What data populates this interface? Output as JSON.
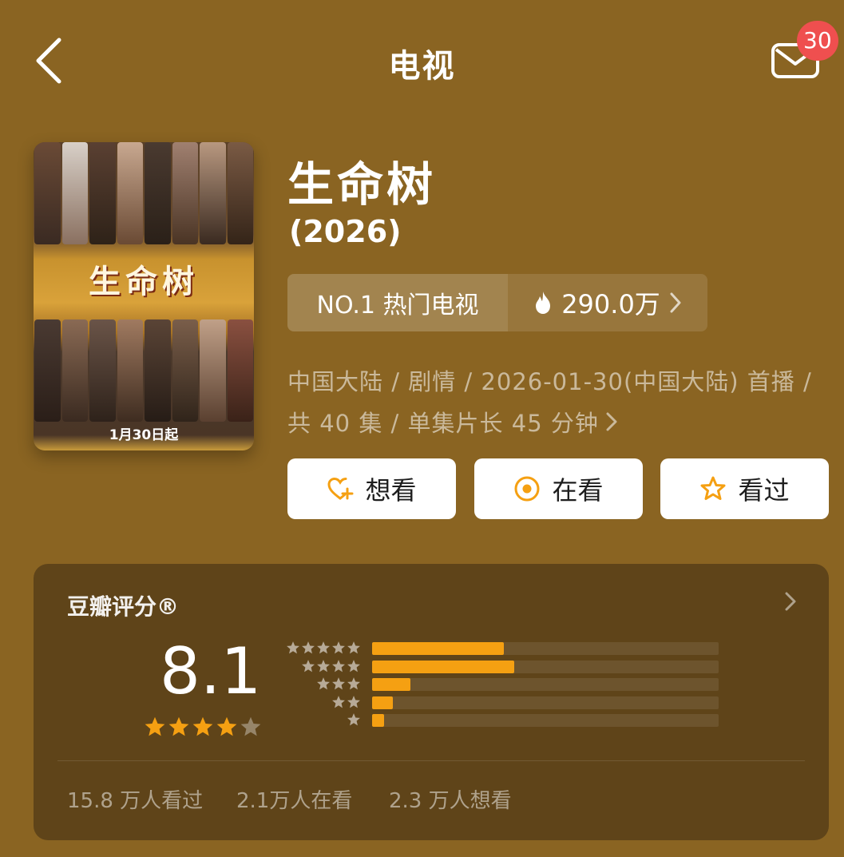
{
  "header": {
    "title": "电视",
    "badge_count": "30",
    "back_icon": "chevron-left-icon",
    "mail_icon": "mail-icon"
  },
  "poster": {
    "title_art": "生命树",
    "date_text": "1月30日起"
  },
  "show": {
    "title": "生命树",
    "year": "(2026)",
    "rank_label": "NO.1 热门电视",
    "heat_value": "290.0万",
    "meta_line1": "中国大陆 / 剧情 / 2026-01-30(中国大陆) 首播 /",
    "meta_line2": "共 40 集 / 单集片长 45 分钟"
  },
  "actions": [
    {
      "label": "想看",
      "icon": "heart-plus-icon"
    },
    {
      "label": "在看",
      "icon": "target-icon"
    },
    {
      "label": "看过",
      "icon": "star-outline-icon"
    }
  ],
  "rating": {
    "title": "豆瓣评分®",
    "score": "8.1",
    "stars_filled": 4,
    "stars_total": 5,
    "distribution": [
      {
        "stars": 5,
        "fraction": 0.38
      },
      {
        "stars": 4,
        "fraction": 0.41
      },
      {
        "stars": 3,
        "fraction": 0.11
      },
      {
        "stars": 2,
        "fraction": 0.06
      },
      {
        "stars": 1,
        "fraction": 0.035
      }
    ],
    "watched_text": "15.8 万人看过",
    "watching_text": "2.1万人在看",
    "want_text": "2.3 万人想看"
  },
  "colors": {
    "background": "#8a6422",
    "accent_orange": "#f5a012",
    "badge_red": "#ef4f4f",
    "button_bg": "#ffffff"
  }
}
